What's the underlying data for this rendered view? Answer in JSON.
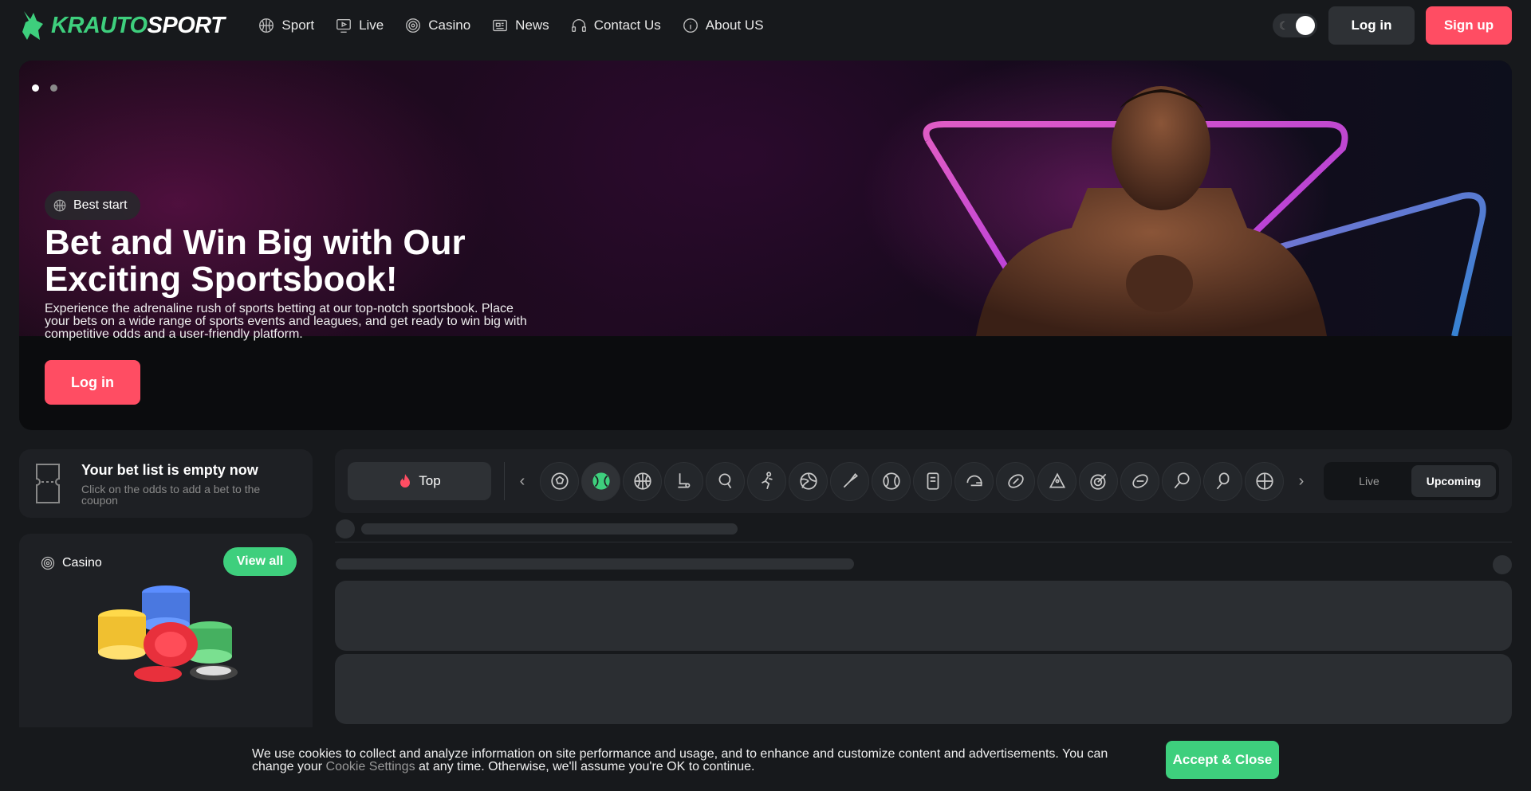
{
  "header": {
    "logo_left": "KRAUTO",
    "logo_right": "SPORT",
    "nav": [
      {
        "label": "Sport",
        "icon": "basketball-icon"
      },
      {
        "label": "Live",
        "icon": "tv-icon"
      },
      {
        "label": "Casino",
        "icon": "casino-chip-icon"
      },
      {
        "label": "News",
        "icon": "newspaper-icon"
      },
      {
        "label": "Contact Us",
        "icon": "headphones-icon"
      },
      {
        "label": "About US",
        "icon": "info-icon"
      }
    ],
    "login_label": "Log in",
    "signup_label": "Sign up"
  },
  "hero": {
    "badge": "Best start",
    "title": "Bet and Win Big with Our Exciting Sportsbook!",
    "description": "Experience the adrenaline rush of sports betting at our top-notch sportsbook. Place your bets on a wide range of sports events and leagues, and get ready to win big with competitive odds and a user-friendly platform.",
    "login_label": "Log in",
    "slides_total": 2,
    "slide_active": 1
  },
  "betlist": {
    "title": "Your bet list is empty now",
    "subtitle": "Click on the odds to add a bet to the coupon"
  },
  "casino": {
    "title": "Casino",
    "view_all": "View all"
  },
  "sports_bar": {
    "top_label": "Top",
    "sports": [
      "soccer-icon",
      "tennis-icon",
      "basketball-icon",
      "ice-hockey-icon",
      "table-tennis-icon",
      "athletics-icon",
      "volleyball-icon",
      "badminton-icon",
      "baseball-icon",
      "esports-icon",
      "american-football-helmet-icon",
      "rugby-icon",
      "snooker-icon",
      "darts-icon",
      "aussie-rules-icon",
      "squash-icon",
      "padel-icon",
      "handball-icon"
    ],
    "active_sport": 1,
    "modes": [
      "Live",
      "Upcoming"
    ],
    "active_mode": "Upcoming"
  },
  "cookie": {
    "text_before": "We use cookies to collect and analyze information on site performance and usage, and to enhance and customize content and advertisements. You can change your ",
    "link": "Cookie Settings",
    "text_after": " at any time. Otherwise, we'll assume you're OK to continue.",
    "accept_label": "Accept & Close"
  },
  "colors": {
    "accent_green": "#3ecf7d",
    "accent_red": "#ff4d63",
    "background": "#17191c",
    "card": "#1e2024"
  }
}
